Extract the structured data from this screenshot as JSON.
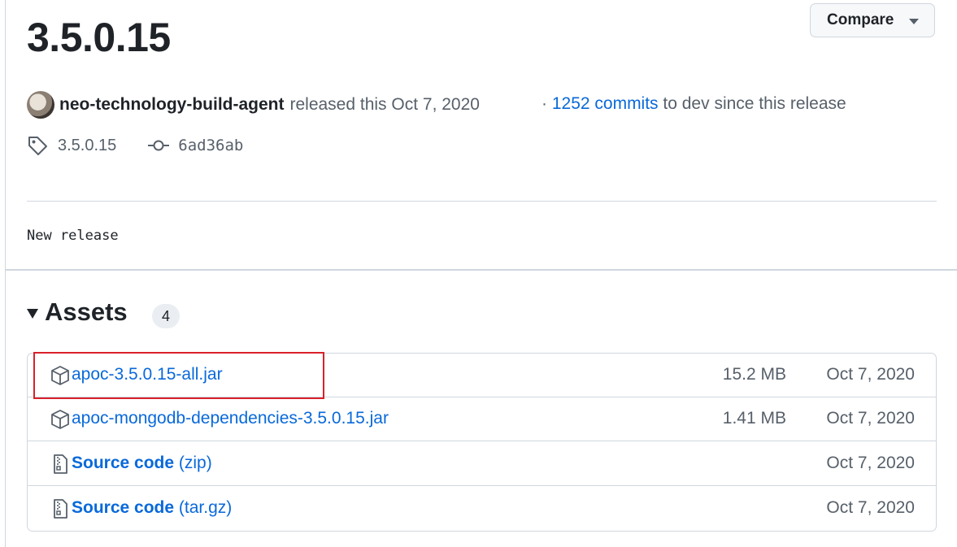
{
  "release": {
    "title": "3.5.0.15",
    "compare_label": "Compare",
    "author": "neo-technology-build-agent",
    "released_text": "released this Oct 7, 2020",
    "commits_prefix": "·",
    "commits_link": "1252 commits",
    "commits_suffix": "to dev since this release",
    "tag": "3.5.0.15",
    "commit_sha": "6ad36ab",
    "notes": "New release"
  },
  "assets": {
    "title": "Assets",
    "count": "4",
    "items": [
      {
        "name": "apoc-3.5.0.15-all.jar",
        "suffix": "",
        "size": "15.2 MB",
        "date": "Oct 7, 2020",
        "icon": "package-icon"
      },
      {
        "name": "apoc-mongodb-dependencies-3.5.0.15.jar",
        "suffix": "",
        "size": "1.41 MB",
        "date": "Oct 7, 2020",
        "icon": "package-icon"
      },
      {
        "name": "Source code",
        "suffix": "(zip)",
        "size": "",
        "date": "Oct 7, 2020",
        "icon": "file-zip-icon"
      },
      {
        "name": "Source code",
        "suffix": "(tar.gz)",
        "size": "",
        "date": "Oct 7, 2020",
        "icon": "file-zip-icon"
      }
    ]
  },
  "colors": {
    "link": "#0969da",
    "highlight": "#d9202a",
    "muted": "#57606a"
  }
}
